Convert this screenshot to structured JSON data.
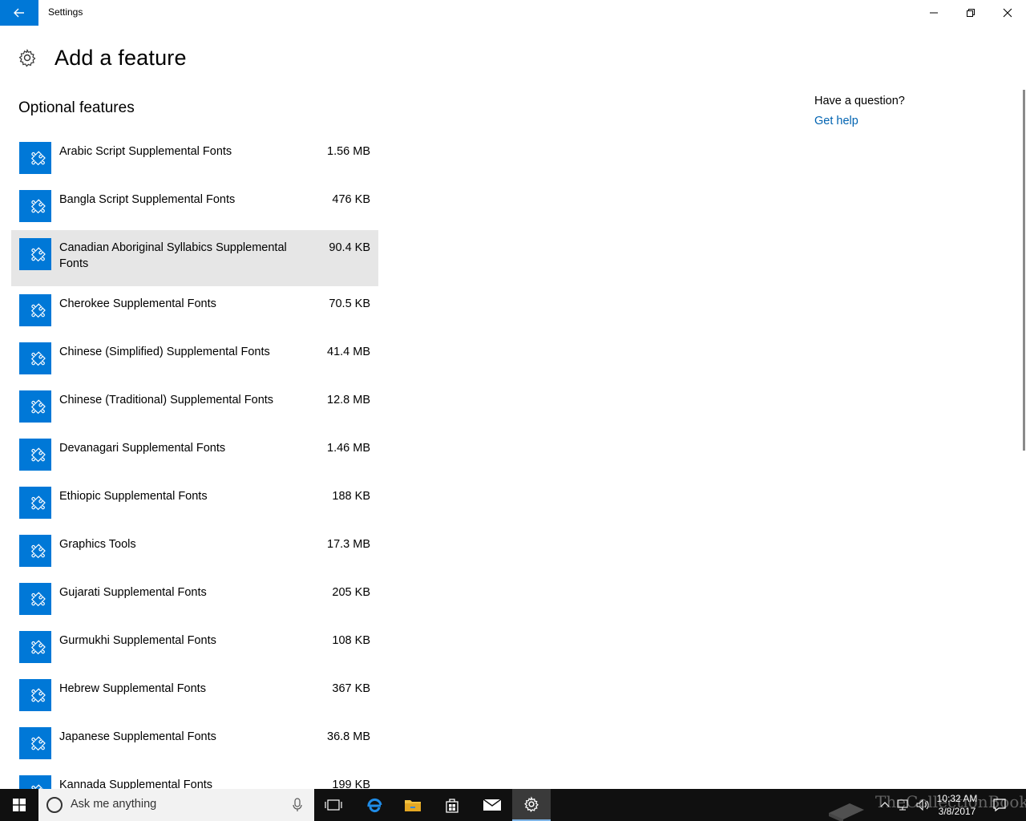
{
  "window": {
    "title": "Settings"
  },
  "header": {
    "title": "Add a feature"
  },
  "section": {
    "title": "Optional features"
  },
  "features": [
    {
      "name": "Arabic Script Supplemental Fonts",
      "size": "1.56 MB"
    },
    {
      "name": "Bangla Script Supplemental Fonts",
      "size": "476 KB"
    },
    {
      "name": "Canadian Aboriginal Syllabics Supplemental Fonts",
      "size": "90.4 KB",
      "selected": true
    },
    {
      "name": "Cherokee Supplemental Fonts",
      "size": "70.5 KB"
    },
    {
      "name": "Chinese (Simplified) Supplemental Fonts",
      "size": "41.4 MB"
    },
    {
      "name": "Chinese (Traditional) Supplemental Fonts",
      "size": "12.8 MB"
    },
    {
      "name": "Devanagari Supplemental Fonts",
      "size": "1.46 MB"
    },
    {
      "name": "Ethiopic Supplemental Fonts",
      "size": "188 KB"
    },
    {
      "name": "Graphics Tools",
      "size": "17.3 MB"
    },
    {
      "name": "Gujarati Supplemental Fonts",
      "size": "205 KB"
    },
    {
      "name": "Gurmukhi Supplemental Fonts",
      "size": "108 KB"
    },
    {
      "name": "Hebrew Supplemental Fonts",
      "size": "367 KB"
    },
    {
      "name": "Japanese Supplemental Fonts",
      "size": "36.8 MB"
    },
    {
      "name": "Kannada Supplemental Fonts",
      "size": "199 KB"
    }
  ],
  "help": {
    "question": "Have a question?",
    "link": "Get help"
  },
  "taskbar": {
    "search_placeholder": "Ask me anything",
    "time": "10:32 AM",
    "date": "3/8/2017",
    "watermark": "TheCollectionBook"
  },
  "colors": {
    "accent": "#0078d7",
    "selected_row": "#e6e6e6",
    "link": "#0063b1",
    "taskbar": "#101010"
  }
}
